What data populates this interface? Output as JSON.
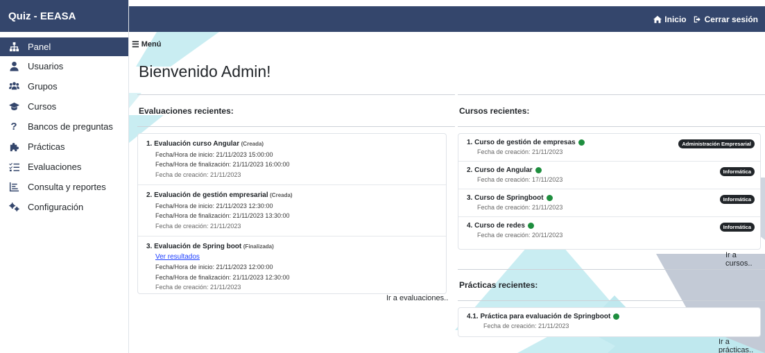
{
  "app": {
    "brand": "Quiz - EEASA"
  },
  "topbar": {
    "home_label": "Inicio",
    "logout_label": "Cerrar sesión"
  },
  "sidebar": {
    "items": [
      {
        "label": "Panel",
        "icon": "sitemap-icon"
      },
      {
        "label": "Usuarios",
        "icon": "user-icon"
      },
      {
        "label": "Grupos",
        "icon": "users-icon"
      },
      {
        "label": "Cursos",
        "icon": "graduation-cap-icon"
      },
      {
        "label": "Bancos de preguntas",
        "icon": "question-icon"
      },
      {
        "label": "Prácticas",
        "icon": "puzzle-icon"
      },
      {
        "label": "Evaluaciones",
        "icon": "list-check-icon"
      },
      {
        "label": "Consulta y reportes",
        "icon": "chart-icon"
      },
      {
        "label": "Configuración",
        "icon": "gears-icon"
      }
    ]
  },
  "main": {
    "menu_label": "Menú",
    "welcome": "Bienvenido Admin!",
    "evaluations": {
      "title": "Evaluaciones recientes:",
      "items": [
        {
          "title": "1.  Evaluación curso Angular",
          "status": "(Creada)",
          "start": "Fecha/Hora de inicio: 21/11/2023 15:00:00",
          "end": "Fecha/Hora de finalización: 21/11/2023 16:00:00",
          "created": "Fecha de creación: 21/11/2023"
        },
        {
          "title": "2.  Evaluación de gestión empresarial",
          "status": "(Creada)",
          "start": "Fecha/Hora de inicio: 21/11/2023 12:30:00",
          "end": "Fecha/Hora de finalización: 21/11/2023 13:30:00",
          "created": "Fecha de creación: 21/11/2023"
        },
        {
          "title": "3.  Evaluación de Spring boot",
          "status": "(Finalizada)",
          "link": "Ver resultados",
          "start": "Fecha/Hora de inicio: 21/11/2023 12:00:00",
          "end": "Fecha/Hora de finalización: 21/11/2023 12:30:00",
          "created": "Fecha de creación: 21/11/2023"
        }
      ],
      "go_link": "Ir a evaluaciones.."
    },
    "courses": {
      "title": "Cursos recientes:",
      "items": [
        {
          "title": "1.  Curso de gestión de empresas",
          "created": "Fecha de creación: 21/11/2023",
          "badge": "Administración Empresarial"
        },
        {
          "title": "2.  Curso de Angular",
          "created": "Fecha de creación: 17/11/2023",
          "badge": "Informática"
        },
        {
          "title": "3.  Curso de Springboot",
          "created": "Fecha de creación: 21/11/2023",
          "badge": "Informática"
        },
        {
          "title": "4.  Curso de redes",
          "created": "Fecha de creación: 20/11/2023",
          "badge": "Informática"
        }
      ],
      "go_link": "Ir a cursos..",
      "status_color": "#1e8e3e"
    },
    "practices": {
      "title": "Prácticas recientes:",
      "items": [
        {
          "title": "4.1.  Práctica para evaluación de Springboot",
          "created": "Fecha de creación: 21/11/2023"
        }
      ],
      "go_link": "Ir a prácticas.."
    }
  },
  "colors": {
    "primary": "#34466c",
    "accent_shape": "#bfe8ee",
    "gray_shape": "#c3cad6"
  }
}
